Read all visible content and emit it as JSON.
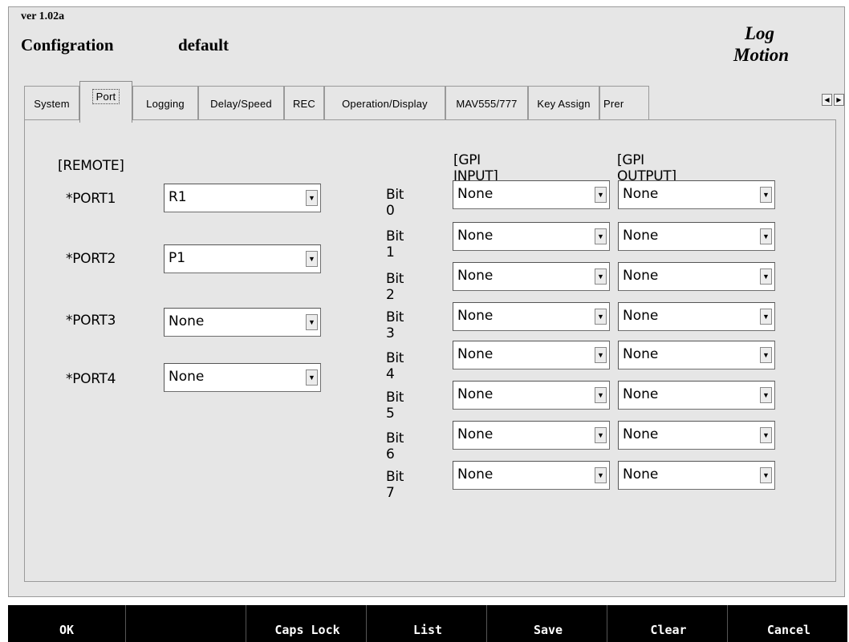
{
  "header": {
    "version": "ver  1.02a",
    "config_label": "Configration",
    "config_name": "default",
    "logo_line1": "Log",
    "logo_line2": "Motion"
  },
  "tabs": [
    {
      "label": "System"
    },
    {
      "label": "Port"
    },
    {
      "label": "Logging"
    },
    {
      "label": "Delay/Speed"
    },
    {
      "label": "REC"
    },
    {
      "label": "Operation/Display"
    },
    {
      "label": "MAV555/777"
    },
    {
      "label": "Key Assign"
    },
    {
      "label": "Prer"
    }
  ],
  "active_tab": "Port",
  "remote": {
    "heading": "[REMOTE]",
    "ports": [
      {
        "label": "*PORT1",
        "value": "R1"
      },
      {
        "label": "*PORT2",
        "value": "P1"
      },
      {
        "label": "*PORT3",
        "value": "None"
      },
      {
        "label": "*PORT4",
        "value": "None"
      }
    ]
  },
  "gpi": {
    "input_heading": "[GPI INPUT]",
    "output_heading": "[GPI OUTPUT]",
    "bits": [
      {
        "label": "Bit 0",
        "input": "None",
        "output": "None"
      },
      {
        "label": "Bit 1",
        "input": "None",
        "output": "None"
      },
      {
        "label": "Bit 2",
        "input": "None",
        "output": "None"
      },
      {
        "label": "Bit 3",
        "input": "None",
        "output": "None"
      },
      {
        "label": "Bit 4",
        "input": "None",
        "output": "None"
      },
      {
        "label": "Bit 5",
        "input": "None",
        "output": "None"
      },
      {
        "label": "Bit 6",
        "input": "None",
        "output": "None"
      },
      {
        "label": "Bit 7",
        "input": "None",
        "output": "None"
      }
    ]
  },
  "function_bar": [
    {
      "label": "OK"
    },
    {
      "label": ""
    },
    {
      "label": "Caps Lock"
    },
    {
      "label": "List"
    },
    {
      "label": "Save"
    },
    {
      "label": "Clear"
    },
    {
      "label": "Cancel"
    }
  ],
  "icons": {
    "dropdown": "chevron-down-icon",
    "tab_left": "arrow-left-icon",
    "tab_right": "arrow-right-icon"
  },
  "colors": {
    "window_bg": "#e6e6e6",
    "bar_bg": "#000000"
  }
}
